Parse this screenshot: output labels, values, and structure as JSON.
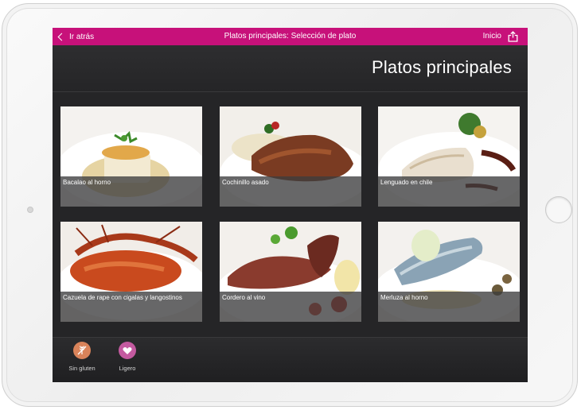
{
  "nav": {
    "back_label": "Ir atrás",
    "title": "Platos principales: Selección de plato",
    "home_label": "Inicio",
    "color": "#c7117a"
  },
  "header": {
    "title": "Platos principales"
  },
  "dishes": [
    {
      "name": "Bacalao al horno",
      "icon": "dish-photo"
    },
    {
      "name": "Cochinillo asado",
      "icon": "dish-photo"
    },
    {
      "name": "Lenguado en chile",
      "icon": "dish-photo"
    },
    {
      "name": "Cazuela de rape con cigalas y langostinos",
      "icon": "dish-photo"
    },
    {
      "name": "Cordero al vino",
      "icon": "dish-photo"
    },
    {
      "name": "Merluza al horno",
      "icon": "dish-photo"
    }
  ],
  "filters": [
    {
      "label": "Sin gluten",
      "icon": "no-wheat-icon",
      "color": "#d9835a"
    },
    {
      "label": "Ligero",
      "icon": "heart-icon",
      "color": "#c45aa0"
    }
  ]
}
